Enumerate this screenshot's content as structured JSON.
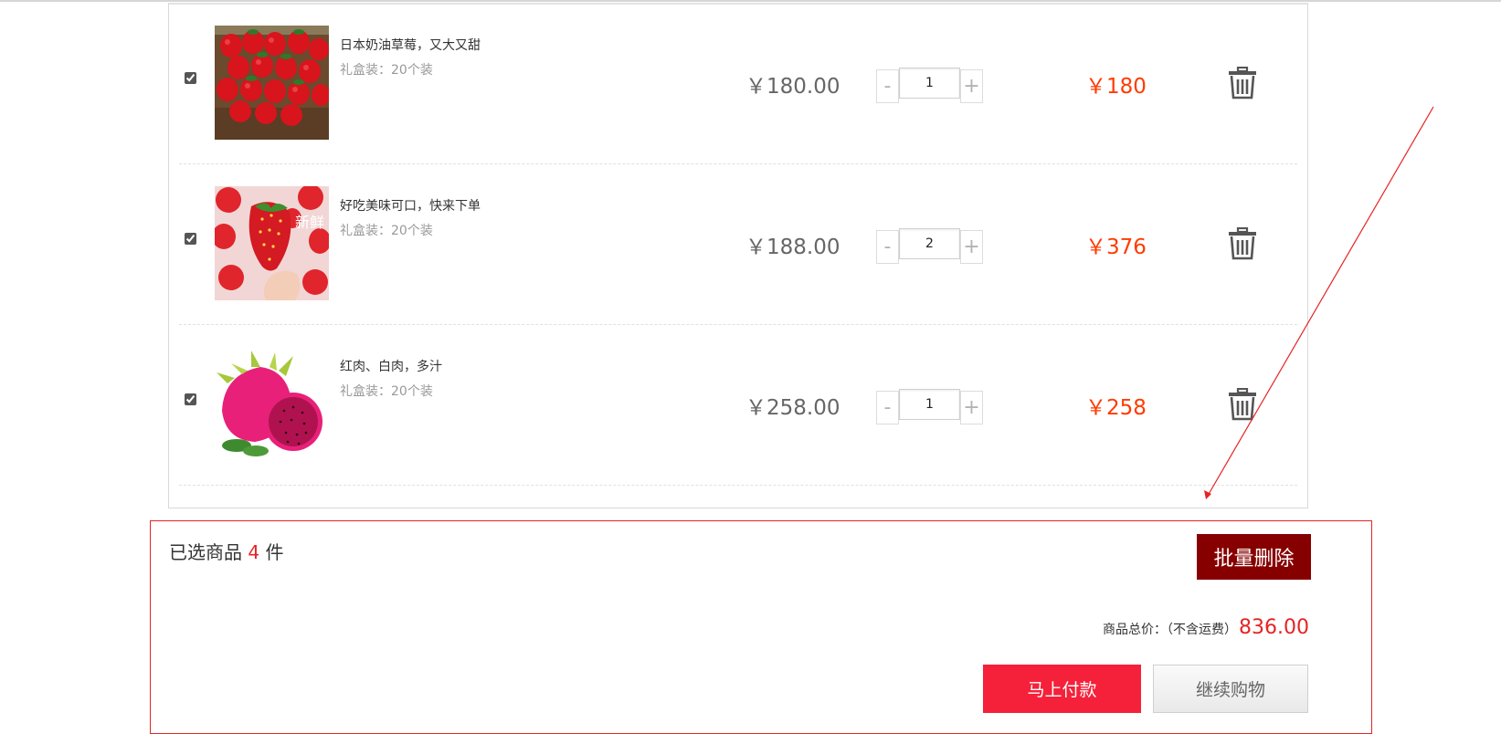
{
  "cart": {
    "items": [
      {
        "name": "日本奶油草莓，又大又甜",
        "spec": "礼盒装：20个装",
        "price": "￥180.00",
        "qty": "1",
        "qty_minus": "-",
        "qty_plus": "+",
        "subtotal": "￥180",
        "checked": true,
        "image": "strawberries-in-crate"
      },
      {
        "name": "好吃美味可口，快来下单",
        "spec": "礼盒装：20个装",
        "price": "￥188.00",
        "qty": "2",
        "qty_minus": "-",
        "qty_plus": "+",
        "subtotal": "￥376",
        "checked": true,
        "image": "strawberry-in-hand",
        "image_text": "新鲜"
      },
      {
        "name": "红肉、白肉，多汁",
        "spec": "礼盒装：20个装",
        "price": "￥258.00",
        "qty": "1",
        "qty_minus": "-",
        "qty_plus": "+",
        "subtotal": "￥258",
        "checked": true,
        "image": "dragon-fruit"
      }
    ],
    "delete_icon": "trash-icon"
  },
  "summary": {
    "selected_prefix": "已选商品",
    "selected_count": "4",
    "selected_suffix": "件",
    "batch_delete_label": "批量删除",
    "total_label": "商品总价：（不含运费）",
    "total_amount": "836.00",
    "pay_label": "马上付款",
    "continue_label": "继续购物"
  },
  "colors": {
    "price_red": "#ff3b00",
    "accent_red": "#e52424",
    "batch_delete_bg": "#870000",
    "pay_button_bg": "#f5213a"
  }
}
